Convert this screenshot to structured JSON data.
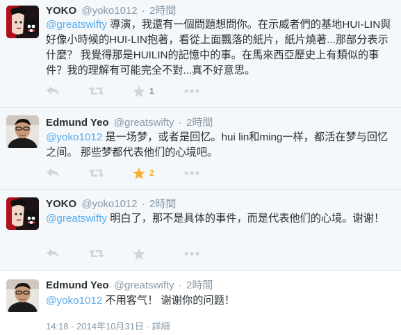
{
  "colors": {
    "link": "#55acee",
    "muted": "#8899a6",
    "icon": "#ccd6dd",
    "favorite_active": "#ffac33",
    "text": "#292f33"
  },
  "tweets": [
    {
      "name": "YOKO",
      "handle": "@yoko1012",
      "dot": "·",
      "time": "2時間",
      "mention": "@greatswifty",
      "text": " 導演，我還有一個問題想問你。在示威者們的基地HUI-LIN與好像小時候的HUI-LIN抱著，看從上面飄落的紙片，紙片燒著...那部分表示什麼？ 我覺得那是HUILIN的記憶中的事。在馬來西亞歷史上有類似的事件？我的理解有可能完全不對...真不好意思。",
      "favorite_count": "1",
      "favorite_active": false
    },
    {
      "name": "Edmund Yeo",
      "handle": "@greatswifty",
      "dot": "·",
      "time": "2時間",
      "mention": "@yoko1012",
      "text": " 是一场梦，或者是回忆。hui lin和ming一样，都活在梦与回忆之间。 那些梦都代表他们的心境吧。",
      "favorite_count": "2",
      "favorite_active": true
    },
    {
      "name": "YOKO",
      "handle": "@yoko1012",
      "dot": "·",
      "time": "2時間",
      "mention": "@greatswifty",
      "text": " 明白了，那不是具体的事件，而是代表他们的心境。谢谢！",
      "favorite_count": "",
      "favorite_active": false
    },
    {
      "name": "Edmund Yeo",
      "handle": "@greatswifty",
      "dot": "·",
      "time": "2時間",
      "mention": "@yoko1012",
      "text": " 不用客气！ 谢谢你的问题！",
      "timestamp": "14:18 - 2014年10月31日",
      "meta_sep": " · ",
      "details_link": "詳細"
    }
  ]
}
